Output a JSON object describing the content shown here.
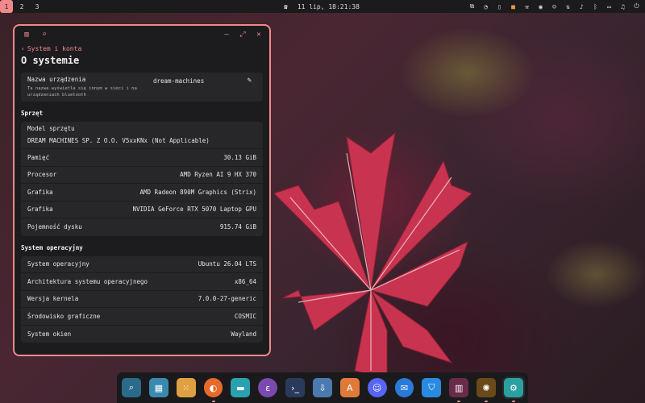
{
  "top_panel": {
    "workspaces": [
      "1",
      "2",
      "3"
    ],
    "active_workspace": "1",
    "clock": "11 lip, 18:21:38",
    "tray_icons": [
      "copy-icon",
      "edge-icon",
      "bookmark-icon",
      "box-icon",
      "tool-icon",
      "steam-icon",
      "discord-icon",
      "network-icon",
      "volume-icon",
      "bluetooth-icon",
      "battery-icon",
      "notification-icon",
      "power-icon"
    ]
  },
  "window": {
    "breadcrumb": "System i konta",
    "title": "O systemie",
    "device_name": {
      "label": "Nazwa urządzenia",
      "description": "Ta nazwa wyświetla się innym w sieci i na urządzeniach bluetooth",
      "value": "dream-machines"
    },
    "hardware": {
      "heading": "Sprzęt",
      "model_label": "Model sprzętu",
      "model_value": "DREAM MACHINES SP. Z O.O. V5xxKNx (Not Applicable)",
      "rows": [
        {
          "label": "Pamięć",
          "value": "30.13 GiB"
        },
        {
          "label": "Procesor",
          "value": "AMD Ryzen AI 9 HX 370"
        },
        {
          "label": "Grafika",
          "value": "AMD Radeon 890M Graphics (Strix)"
        },
        {
          "label": "Grafika",
          "value": "NVIDIA GeForce RTX 5070 Laptop GPU"
        },
        {
          "label": "Pojemność dysku",
          "value": "915.74 GiB"
        }
      ]
    },
    "os": {
      "heading": "System operacyjny",
      "rows": [
        {
          "label": "System operacyjny",
          "value": "Ubuntu 26.04 LTS"
        },
        {
          "label": "Architektura systemu operacyjnego",
          "value": "x86_64"
        },
        {
          "label": "Wersja kernela",
          "value": "7.0.0-27-generic"
        },
        {
          "label": "Środowisko graficzne",
          "value": "COSMIC"
        },
        {
          "label": "System okien",
          "value": "Wayland"
        }
      ]
    }
  },
  "dock": {
    "items": [
      "search-app-icon",
      "workspaces-icon",
      "app-grid-icon",
      "firefox-icon",
      "files-icon",
      "emacs-icon",
      "terminal-icon",
      "installer-icon",
      "appcenter-icon",
      "discord-icon",
      "thunderbird-icon",
      "shield-icon",
      "audio-visualizer-icon",
      "sun-app-icon",
      "settings-icon"
    ]
  },
  "accent": "#f08a8a"
}
